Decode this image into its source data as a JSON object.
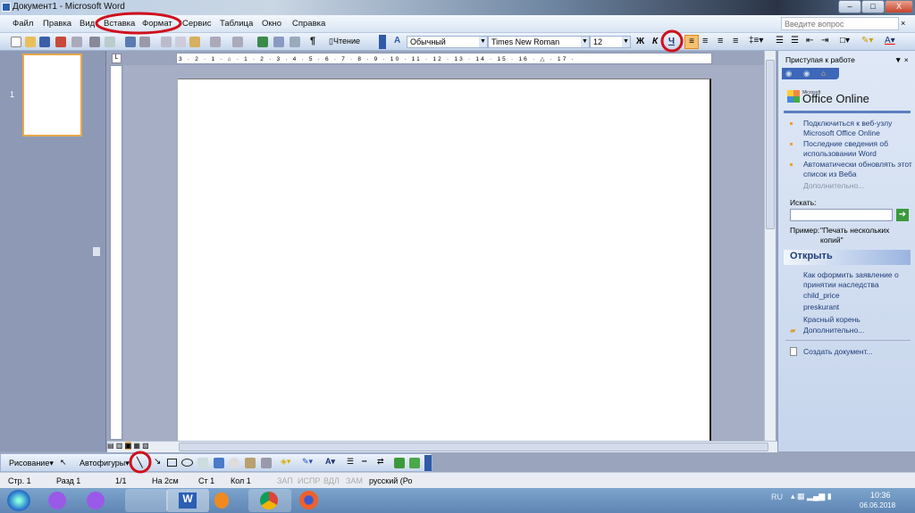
{
  "window": {
    "title": "Документ1 - Microsoft Word",
    "minimize": "–",
    "maximize": "□",
    "close": "X"
  },
  "menu": {
    "items": [
      "Файл",
      "Правка",
      "Вид",
      "Вставка",
      "Формат",
      "Сервис",
      "Таблица",
      "Окно",
      "Справка"
    ],
    "ask_placeholder": "Введите вопрос"
  },
  "toolbar": {
    "reading": "Чтение",
    "style": "Обычный",
    "font": "Times New Roman",
    "size": "12",
    "bold": "Ж",
    "italic": "К",
    "underline": "Ч"
  },
  "ruler": {
    "h_marks": "3 · 2 · 1 · ⌂ · 1 · 2 · 3 · 4 · 5 · 6 · 7 · 8 · 9 · 10 · 11 · 12 · 13 · 14 · 15 · 16 · △ · 17 ·",
    "corner": "L"
  },
  "thumbnails": {
    "page_number": "1"
  },
  "task_pane": {
    "title": "Приступая к работе",
    "brand_small": "Microsoft",
    "brand": "Office Online",
    "links": [
      "Подключиться к веб-узлу Microsoft Office Online",
      "Последние сведения об использовании Word",
      "Автоматически обновлять этот список из Веба"
    ],
    "more": "Дополнительно...",
    "search_label": "Искать:",
    "search_value": "",
    "example_label": "Пример:",
    "example_text": "\"Печать нескольких копий\"",
    "open_header": "Открыть",
    "recent": [
      "Как оформить заявление о принятии наследства",
      "child_price",
      "preskurant",
      "Красный корень"
    ],
    "open_more": "Дополнительно...",
    "new_doc": "Создать документ..."
  },
  "drawing": {
    "draw": "Рисование",
    "autoshapes": "Автофигуры"
  },
  "status": {
    "page": "Стр. 1",
    "section": "Разд 1",
    "pages": "1/1",
    "at": "На 2см",
    "line": "Ст 1",
    "col": "Кол 1",
    "rec": "ЗАП",
    "trk": "ИСПР",
    "ext": "ВДЛ",
    "ovr": "ЗАМ",
    "lang": "русский (Ро"
  },
  "taskbar": {
    "lang": "RU",
    "time": "10:36",
    "date": "06.06.2018"
  },
  "colors": {
    "annotation": "#d0101c",
    "accent": "#f0a030"
  }
}
